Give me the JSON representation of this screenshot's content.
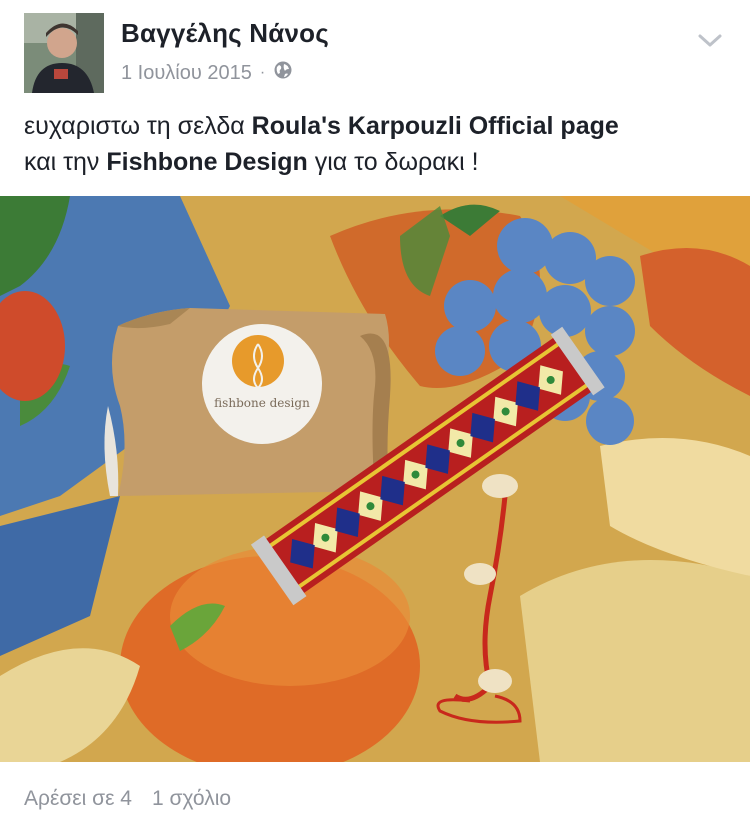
{
  "post": {
    "author": "Βαγγέλης Νάνος",
    "date": "1 Ιουλίου 2015",
    "separator": "·",
    "audience_icon": "globe-icon",
    "menu_icon": "chevron-down-icon",
    "text_parts": [
      "ευχαριστω τη σελδα ",
      "Roula's Karpouzli Official page",
      " και την ",
      "Fishbone Design",
      " για το δωρακι !"
    ],
    "photo": {
      "sticker_text": "fishbone design"
    }
  },
  "footer": {
    "likes": "Αρέσει σε 4",
    "comments": "1 σχόλιο"
  },
  "colors": {
    "text": "#1d2129",
    "muted": "#90949c",
    "sticker_orange": "#e79a2b"
  }
}
